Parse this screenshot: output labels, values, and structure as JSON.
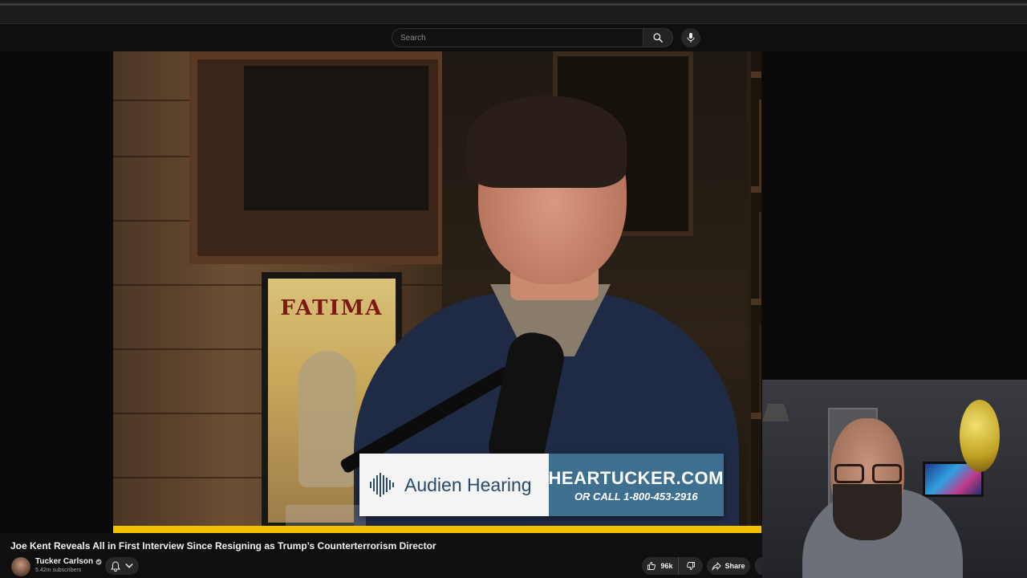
{
  "search": {
    "placeholder": "Search"
  },
  "icons": {
    "search": "search-icon",
    "mic": "microphone-icon",
    "bell": "bell-icon",
    "chevron": "chevron-down-icon",
    "like": "thumbs-up-icon",
    "dislike": "thumbs-down-icon",
    "share": "share-icon",
    "verified": "verified-icon"
  },
  "video": {
    "poster_text": "FATIMA",
    "ad": {
      "brand": "Audien Hearing",
      "url": "HEARTUCKER.COM",
      "phone": "OR CALL 1-800-453-2916"
    },
    "progress_fraction": 1.0,
    "title": "Joe Kent Reveals All in First Interview Since Resigning as Trump’s Counterterrorism Director"
  },
  "channel": {
    "name": "Tucker Carlson",
    "subscribers": "5.42m subscribers"
  },
  "actions": {
    "like_count": "96k",
    "share_label": "Share"
  },
  "colors": {
    "progress": "#f2c200",
    "ad_blue": "#3f6f8f",
    "background": "#0f0f0f"
  }
}
